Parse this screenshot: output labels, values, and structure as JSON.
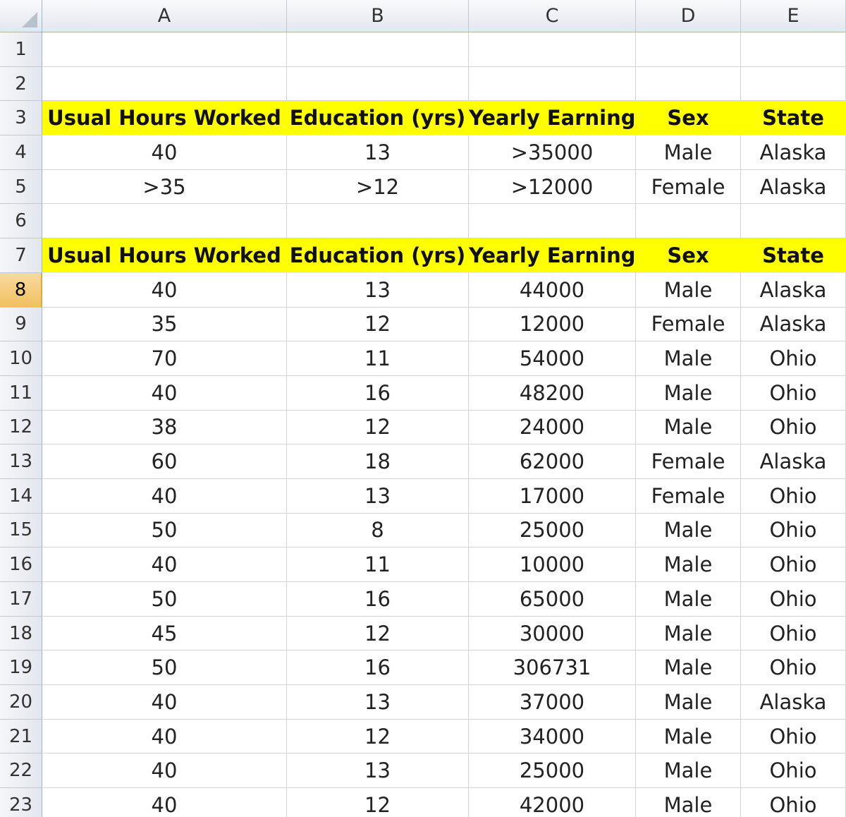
{
  "column_headers": [
    "A",
    "B",
    "C",
    "D",
    "E"
  ],
  "row_numbers": [
    "1",
    "2",
    "3",
    "4",
    "5",
    "6",
    "7",
    "8",
    "9",
    "10",
    "11",
    "12",
    "13",
    "14",
    "15",
    "16",
    "17",
    "18",
    "19",
    "20",
    "21",
    "22",
    "23"
  ],
  "selected_row": "8",
  "rows": [
    [
      "",
      "",
      "",
      "",
      ""
    ],
    [
      "",
      "",
      "",
      "",
      ""
    ],
    [
      "Usual Hours Worked",
      "Education (yrs)",
      "Yearly Earnings",
      "Sex",
      "State"
    ],
    [
      "40",
      "13",
      ">35000",
      "Male",
      "Alaska"
    ],
    [
      ">35",
      ">12",
      ">12000",
      "Female",
      "Alaska"
    ],
    [
      "",
      "",
      "",
      "",
      ""
    ],
    [
      "Usual Hours Worked",
      "Education (yrs)",
      "Yearly Earnings",
      "Sex",
      "State"
    ],
    [
      "40",
      "13",
      "44000",
      "Male",
      "Alaska"
    ],
    [
      "35",
      "12",
      "12000",
      "Female",
      "Alaska"
    ],
    [
      "70",
      "11",
      "54000",
      "Male",
      "Ohio"
    ],
    [
      "40",
      "16",
      "48200",
      "Male",
      "Ohio"
    ],
    [
      "38",
      "12",
      "24000",
      "Male",
      "Ohio"
    ],
    [
      "60",
      "18",
      "62000",
      "Female",
      "Alaska"
    ],
    [
      "40",
      "13",
      "17000",
      "Female",
      "Ohio"
    ],
    [
      "50",
      "8",
      "25000",
      "Male",
      "Ohio"
    ],
    [
      "40",
      "11",
      "10000",
      "Male",
      "Ohio"
    ],
    [
      "50",
      "16",
      "65000",
      "Male",
      "Ohio"
    ],
    [
      "45",
      "12",
      "30000",
      "Male",
      "Ohio"
    ],
    [
      "50",
      "16",
      "306731",
      "Male",
      "Ohio"
    ],
    [
      "40",
      "13",
      "37000",
      "Male",
      "Alaska"
    ],
    [
      "40",
      "12",
      "34000",
      "Male",
      "Ohio"
    ],
    [
      "40",
      "13",
      "25000",
      "Male",
      "Ohio"
    ],
    [
      "40",
      "12",
      "42000",
      "Male",
      "Ohio"
    ]
  ],
  "header_row_numbers": [
    "3",
    "7"
  ],
  "header_fill_color": "#ffff00",
  "selected_row_color": "#f1c15f"
}
